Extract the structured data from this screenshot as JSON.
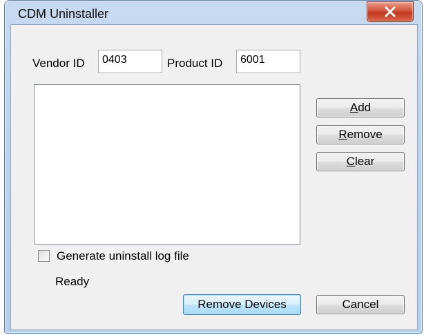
{
  "window": {
    "title": "CDM Uninstaller"
  },
  "vendor": {
    "label": "Vendor ID",
    "value": "0403"
  },
  "product": {
    "label": "Product ID",
    "value": "6001"
  },
  "device_list": {
    "items": []
  },
  "buttons": {
    "add": {
      "accel": "A",
      "rest": "dd"
    },
    "remove": {
      "accel": "R",
      "rest": "emove"
    },
    "clear": {
      "accel": "C",
      "rest": "lear"
    },
    "remove_devices": "Remove Devices",
    "cancel": "Cancel"
  },
  "log_option": {
    "label": "Generate uninstall log file",
    "checked": false
  },
  "status": "Ready",
  "icons": {
    "close": "close-icon"
  }
}
